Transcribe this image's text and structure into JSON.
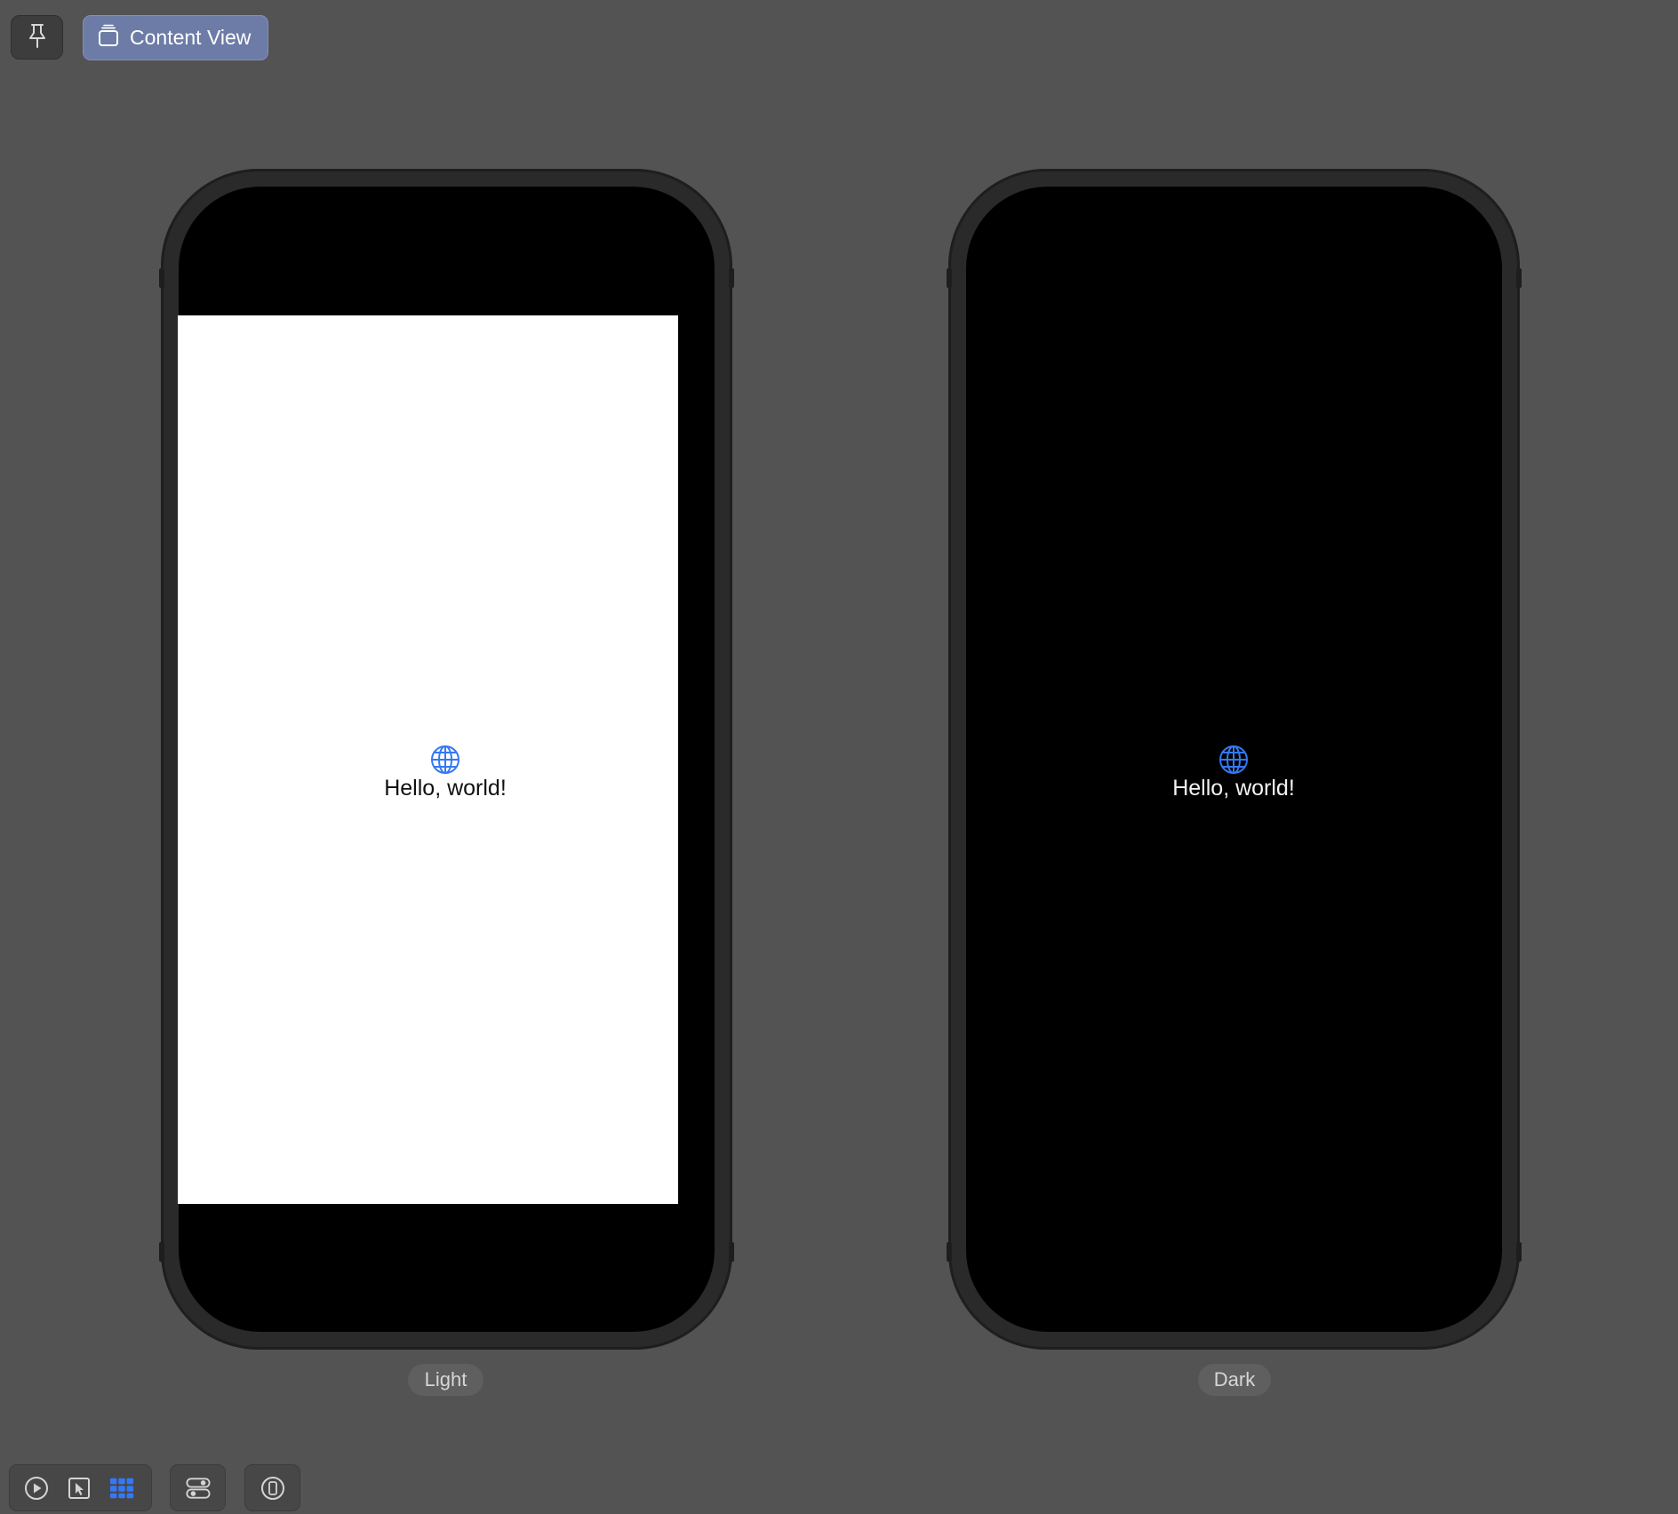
{
  "toolbar": {
    "pin_icon": "pin-icon",
    "content_view_label": "Content View",
    "content_view_icon": "stack-icon"
  },
  "previews": [
    {
      "variant": "Light",
      "text": "Hello, world!",
      "icon": "globe-icon",
      "background": "#ffffff",
      "text_color": "#111111"
    },
    {
      "variant": "Dark",
      "text": "Hello, world!",
      "icon": "globe-icon",
      "background": "#000000",
      "text_color": "#f2f2f2"
    }
  ],
  "bottom_toolbar": {
    "icons": [
      "play-icon",
      "select-cursor-icon",
      "grid-icon",
      "toggles-icon",
      "device-icon"
    ],
    "active": "grid-icon"
  },
  "colors": {
    "canvas": "#535353",
    "accent": "#3478f6",
    "content_view_button": "#6d7ca6"
  }
}
